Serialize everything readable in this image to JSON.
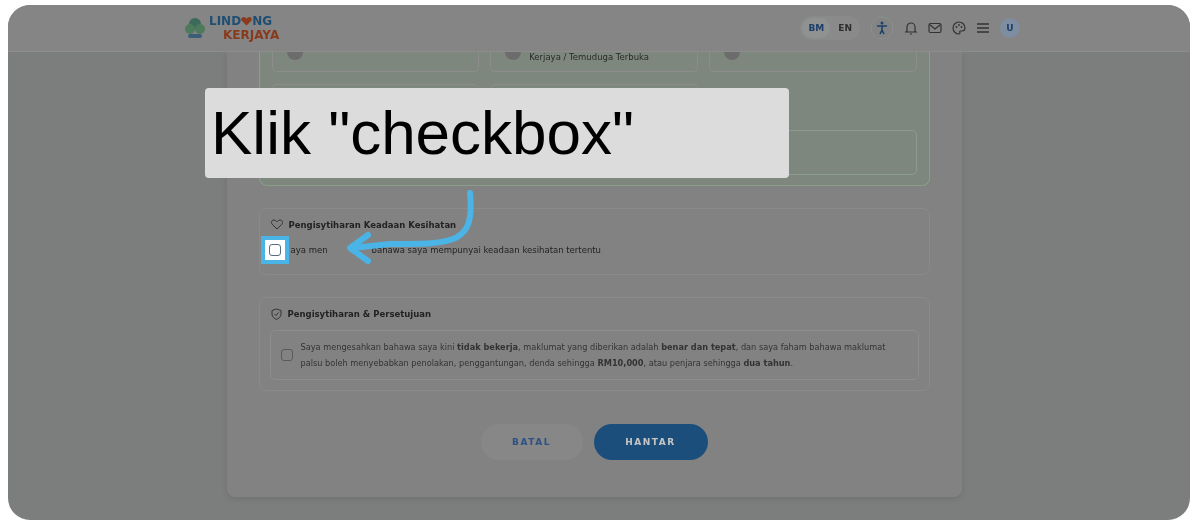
{
  "header": {
    "logo": {
      "text_before": "LIND",
      "text_after": "NG",
      "subtitle": "KERJAYA"
    },
    "language_options": [
      {
        "label": "BM",
        "selected": true
      },
      {
        "label": "EN",
        "selected": false
      }
    ],
    "avatar": "U"
  },
  "summary": {
    "top_row": [
      {
        "kind": "blank"
      },
      {
        "kind": "labelled",
        "label": "Kerjaya / Temuduga Terbuka"
      },
      {
        "kind": "blank"
      }
    ]
  },
  "health_section": {
    "title": "Pengisytiharan Keadaan Kesihatan",
    "checkbox": {
      "label_start": "aya men",
      "label_end": "bahawa saya mempunyai keadaan kesihatan tertentu",
      "checked": false
    }
  },
  "declaration_section": {
    "title": "Pengisytiharan & Persetujuan",
    "checkbox": {
      "label": "Saya mengesahkan bahawa saya kini **tidak bekerja**, maklumat yang diberikan adalah **benar dan tepat**, dan saya faham bahawa maklumat palsu boleh menyebabkan penolakan, penggantungan, denda sehingga **RM10,000**, atau penjara sehingga **dua tahun**.",
      "checked": false
    }
  },
  "buttons": [
    {
      "label": "BATAL",
      "kind": "secondary"
    },
    {
      "label": "HANTAR",
      "kind": "primary"
    }
  ],
  "tutorial": {
    "instruction": "Klik \"checkbox\""
  }
}
